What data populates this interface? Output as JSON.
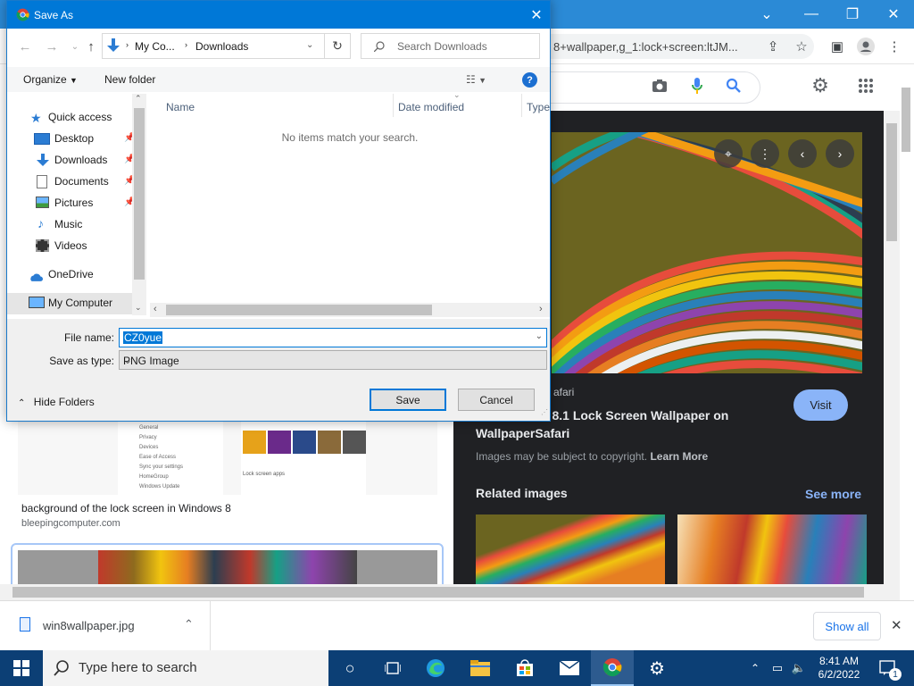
{
  "browser": {
    "url_fragment": "8+wallpaper,g_1:lock+screen:ltJM...",
    "icons": [
      "camera-icon",
      "mic-icon",
      "search-icon",
      "gear-icon",
      "apps-icon"
    ]
  },
  "results": {
    "mini_settings": [
      "General",
      "Privacy",
      "Devices",
      "Ease of Access",
      "Sync your settings",
      "HomeGroup",
      "Windows Update"
    ],
    "mini_text": "Lock screen apps",
    "result_title": "background of the lock screen in Windows 8",
    "result_site": "bleepingcomputer.com"
  },
  "preview": {
    "source": "afari",
    "title_line1": "vs 8.1 Lock Screen Wallpaper on",
    "title_line2": "WallpaperSafari",
    "visit_label": "Visit",
    "copyright_text": "Images may be subject to copyright.",
    "learn_more": "Learn More",
    "related_label": "Related images",
    "see_more": "See more"
  },
  "downloads": {
    "file_name": "win8wallpaper.jpg",
    "show_all": "Show all"
  },
  "taskbar": {
    "search_placeholder": "Type here to search",
    "time": "8:41 AM",
    "date": "6/2/2022",
    "notification_count": "1"
  },
  "dialog": {
    "title": "Save As",
    "breadcrumb": [
      "My Co...",
      "Downloads"
    ],
    "search_placeholder": "Search Downloads",
    "organize": "Organize",
    "new_folder": "New folder",
    "nav_items": [
      {
        "label": "Quick access",
        "icon": "star-icon"
      },
      {
        "label": "Desktop",
        "icon": "desktop-icon"
      },
      {
        "label": "Downloads",
        "icon": "download-icon"
      },
      {
        "label": "Documents",
        "icon": "document-icon"
      },
      {
        "label": "Pictures",
        "icon": "picture-icon"
      },
      {
        "label": "Music",
        "icon": "music-icon"
      },
      {
        "label": "Videos",
        "icon": "video-icon"
      },
      {
        "label": "OneDrive",
        "icon": "cloud-icon"
      },
      {
        "label": "My Computer",
        "icon": "computer-icon"
      }
    ],
    "columns": [
      "Name",
      "Date modified",
      "Type"
    ],
    "empty_message": "No items match your search.",
    "file_name_label": "File name:",
    "file_name_value": "CZ0yue",
    "save_type_label": "Save as type:",
    "save_type_value": "PNG Image",
    "hide_folders": "Hide Folders",
    "save_button": "Save",
    "cancel_button": "Cancel"
  }
}
